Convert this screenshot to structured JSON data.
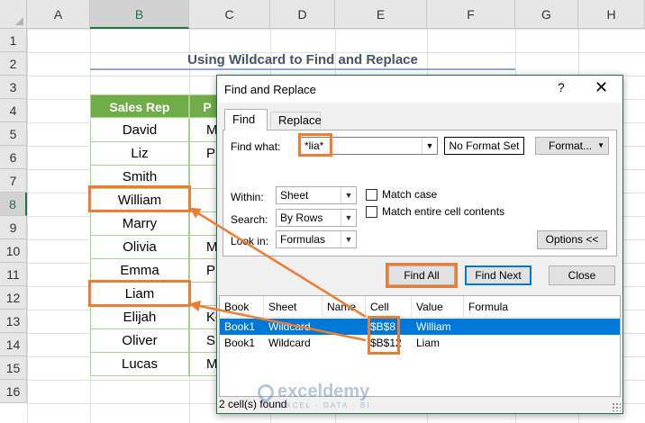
{
  "sheet": {
    "columns": [
      "A",
      "B",
      "C",
      "D",
      "E",
      "F",
      "G",
      "H"
    ],
    "selected_column": "B",
    "rows": [
      "1",
      "2",
      "3",
      "4",
      "5",
      "6",
      "7",
      "8",
      "9",
      "10",
      "11",
      "12",
      "13",
      "14",
      "15",
      "16"
    ],
    "selected_row": "8",
    "title": "Using Wildcard to Find and Replace",
    "table": {
      "headers": [
        "Sales Rep",
        "P"
      ],
      "rows": [
        [
          "David",
          "M"
        ],
        [
          "Liz",
          "P"
        ],
        [
          "Smith",
          ""
        ],
        [
          "William",
          ""
        ],
        [
          "Marry",
          ""
        ],
        [
          "Olivia",
          "M"
        ],
        [
          "Emma",
          "P"
        ],
        [
          "Liam",
          ""
        ],
        [
          "Elijah",
          "Ke"
        ],
        [
          "Oliver",
          "Sp"
        ],
        [
          "Lucas",
          "Mic"
        ]
      ]
    }
  },
  "dialog": {
    "title": "Find and Replace",
    "help_glyph": "?",
    "close_glyph": "✕",
    "tabs": [
      "Find",
      "Replace"
    ],
    "find_what_label": "Find what:",
    "find_what_value": "*lia*",
    "format_status": "No Format Set",
    "format_button": "Format...",
    "within_label": "Within:",
    "within_value": "Sheet",
    "search_label": "Search:",
    "search_value": "By Rows",
    "look_in_label": "Look in:",
    "look_in_value": "Formulas",
    "match_case": "Match case",
    "match_entire": "Match entire cell contents",
    "options_button": "Options <<",
    "find_all_button": "Find All",
    "find_next_button": "Find Next",
    "close_button": "Close",
    "results": {
      "headers": [
        "Book",
        "Sheet",
        "Name",
        "Cell",
        "Value",
        "Formula"
      ],
      "rows": [
        [
          "Book1",
          "Wildcard",
          "",
          "$B$8",
          "William",
          ""
        ],
        [
          "Book1",
          "Wildcard",
          "",
          "$B$12",
          "Liam",
          ""
        ]
      ],
      "selected_row": 0
    },
    "status": "2 cell(s) found"
  },
  "watermark": {
    "name": "exceldemy",
    "tagline": "EXCEL · DATA · BI"
  },
  "colors": {
    "accent": "#217346",
    "highlight": "#ed7d31",
    "table_header": "#70ad47",
    "selection": "#0078d7"
  }
}
